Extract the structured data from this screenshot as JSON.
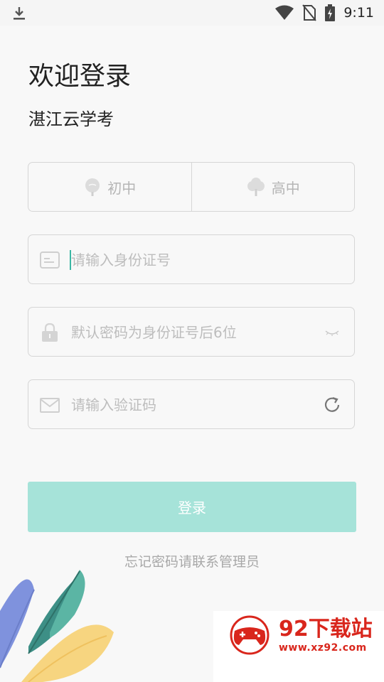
{
  "status_bar": {
    "time": "9:11",
    "icons": [
      "download-icon",
      "wifi-icon",
      "no-sim-icon",
      "battery-charging-icon"
    ]
  },
  "header": {
    "title": "欢迎登录",
    "subtitle": "湛江云学考"
  },
  "school_level": {
    "options": [
      {
        "label": "初中",
        "icon": "seedling-icon"
      },
      {
        "label": "高中",
        "icon": "tree-icon"
      }
    ]
  },
  "form": {
    "id_number": {
      "placeholder": "请输入身份证号",
      "value": "",
      "icon": "id-card-icon"
    },
    "password": {
      "placeholder": "默认密码为身份证号后6位",
      "value": "",
      "icon": "lock-icon",
      "toggle_icon": "eye-closed-icon"
    },
    "captcha": {
      "placeholder": "请输入验证码",
      "value": "",
      "icon": "mail-icon",
      "refresh_icon": "refresh-icon"
    }
  },
  "actions": {
    "login_label": "登录",
    "forgot_text": "忘记密码请联系管理员"
  },
  "watermark": {
    "name": "92下载站",
    "url": "www.xz92.com"
  },
  "colors": {
    "accent": "#a6e3d9",
    "caret": "#3bb7a4",
    "watermark": "#d9261c"
  }
}
